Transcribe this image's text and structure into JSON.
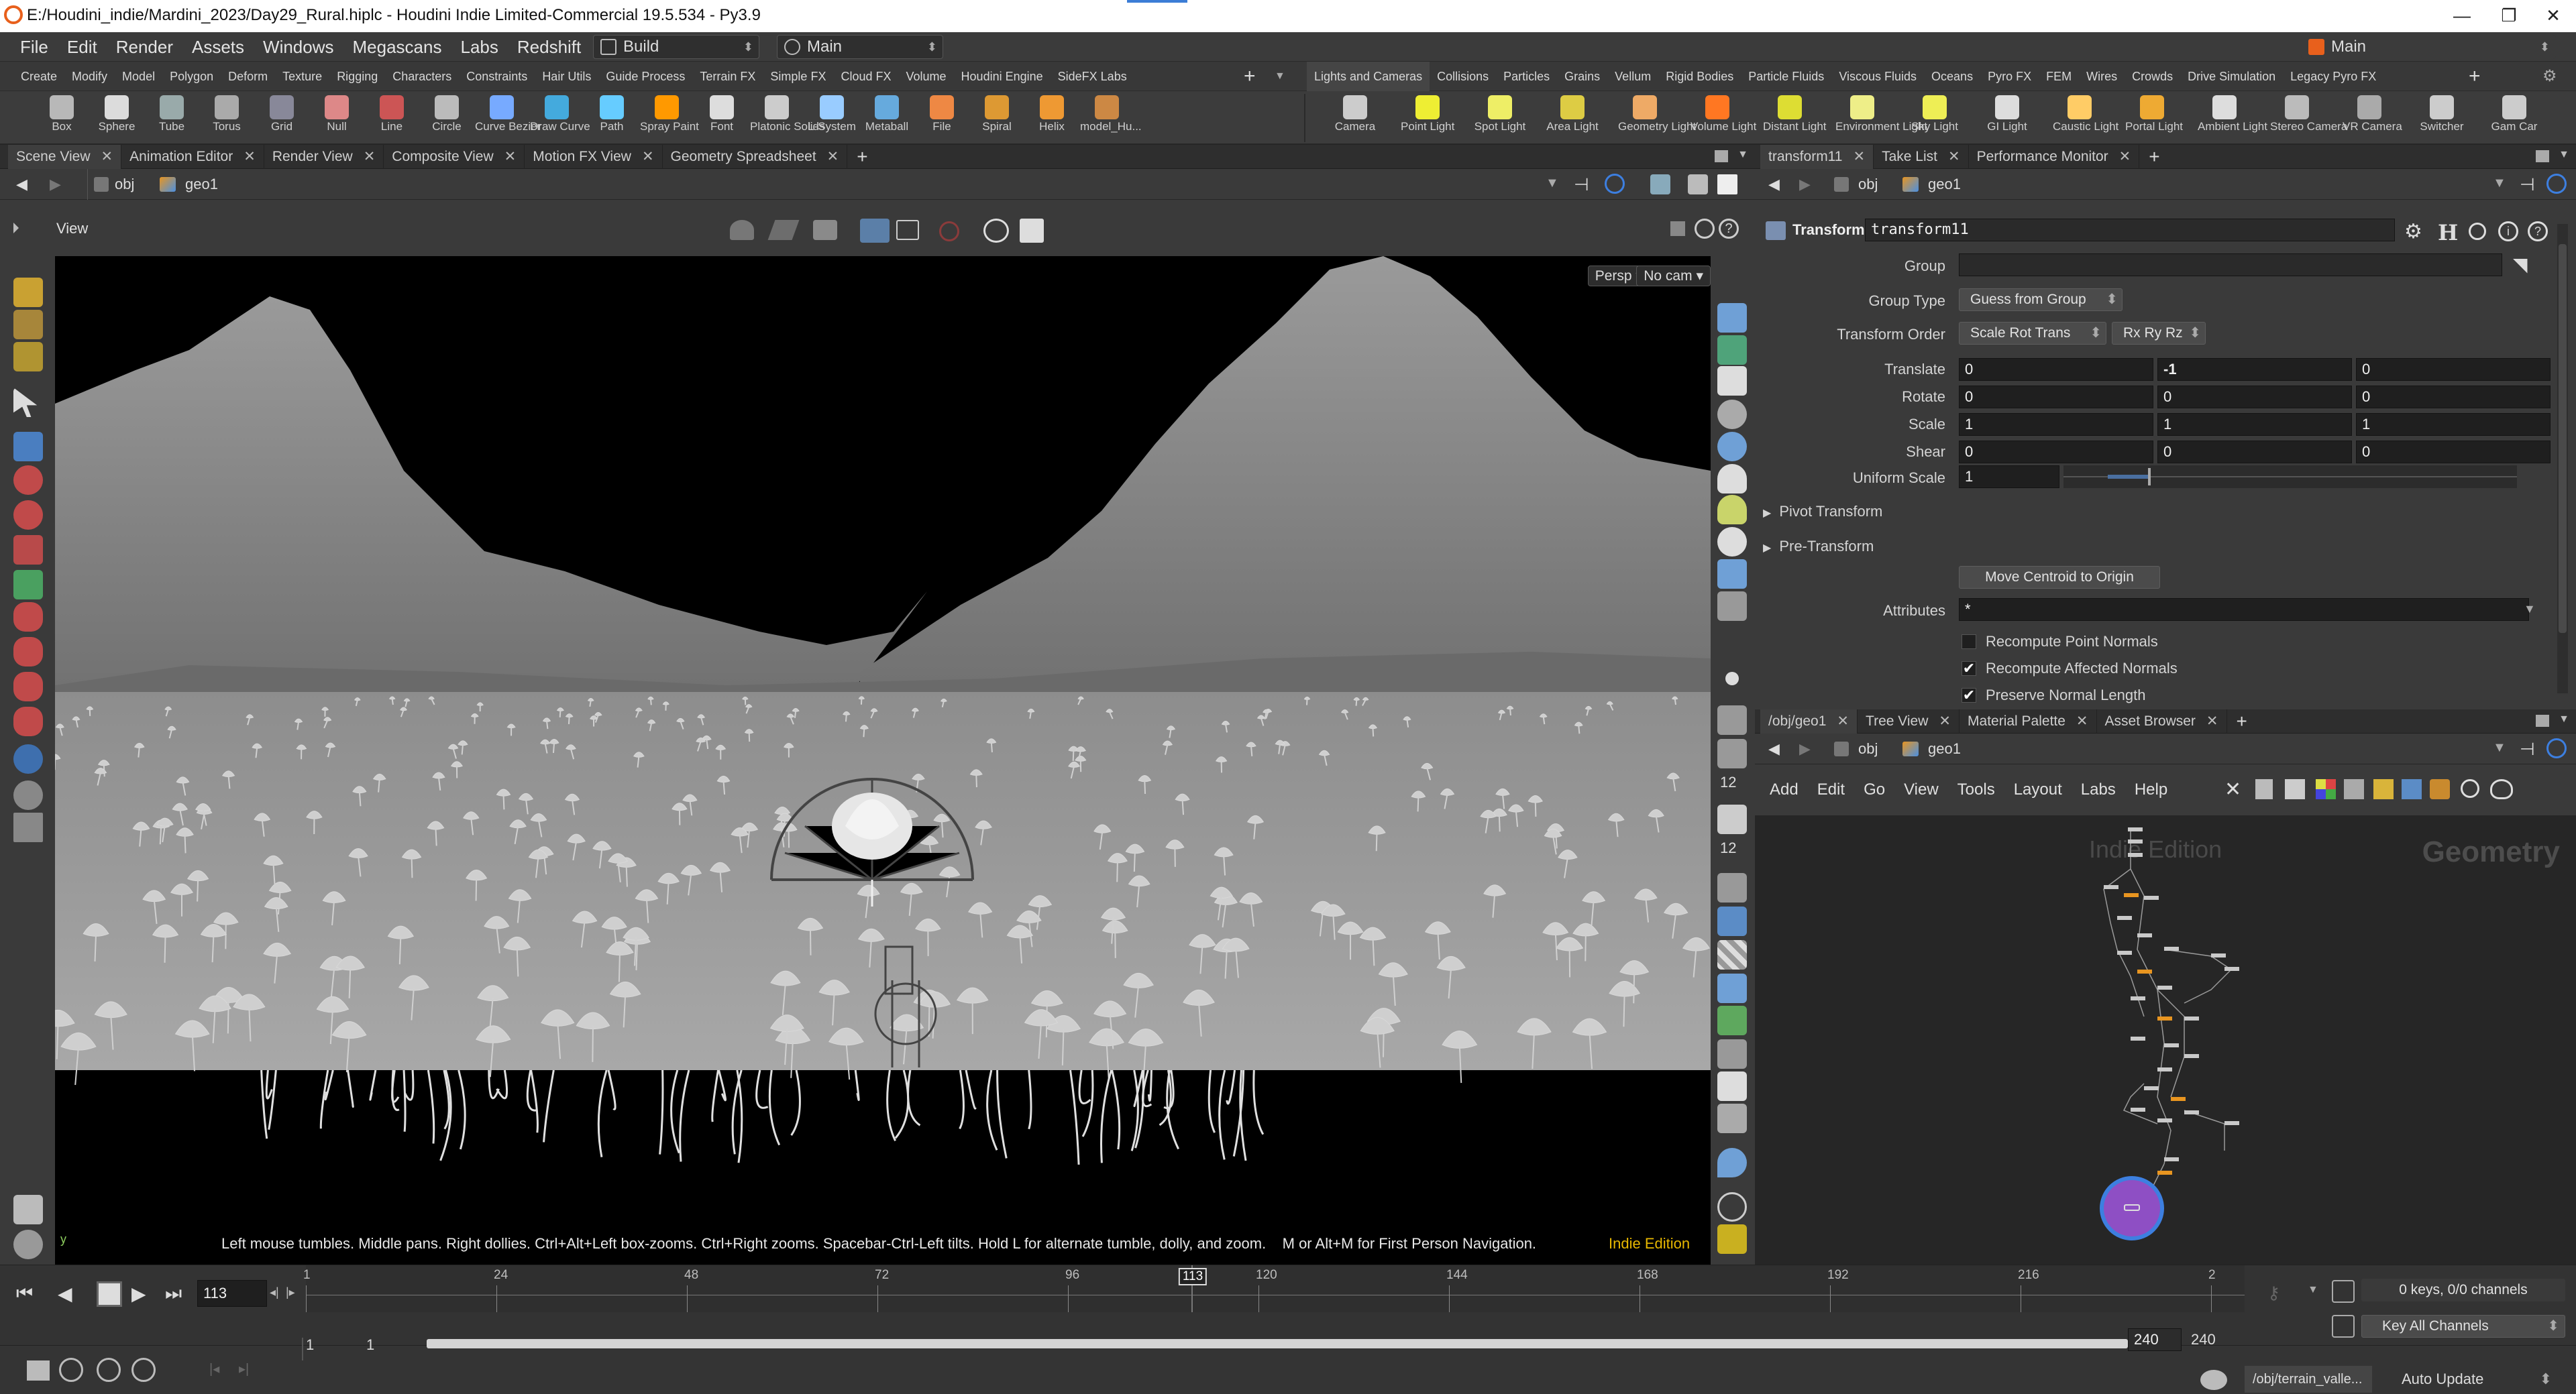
{
  "window": {
    "title": "E:/Houdini_indie/Mardini_2023/Day29_Rural.hiplc - Houdini Indie Limited-Commercial 19.5.534 - Py3.9",
    "controls": [
      "—",
      "❐",
      "✕"
    ]
  },
  "menubar": {
    "items": [
      "File",
      "Edit",
      "Render",
      "Assets",
      "Windows",
      "Megascans",
      "Labs",
      "Redshift",
      "Help"
    ],
    "desktop": "Build",
    "workspace": "Main",
    "right_workspace": "Main"
  },
  "shelf": {
    "left_tabs": [
      "Create",
      "Modify",
      "Model",
      "Polygon",
      "Deform",
      "Texture",
      "Rigging",
      "Characters",
      "Constraints",
      "Hair Utils",
      "Guide Process",
      "Terrain FX",
      "Simple FX",
      "Cloud FX",
      "Volume",
      "Houdini Engine",
      "SideFX Labs"
    ],
    "right_tabs": [
      "Lights and Cameras",
      "Collisions",
      "Particles",
      "Grains",
      "Vellum",
      "Rigid Bodies",
      "Particle Fluids",
      "Viscous Fluids",
      "Oceans",
      "Pyro FX",
      "FEM",
      "Wires",
      "Crowds",
      "Drive Simulation",
      "Legacy Pyro FX"
    ],
    "left_tools": [
      "Box",
      "Sphere",
      "Tube",
      "Torus",
      "Grid",
      "Null",
      "Line",
      "Circle",
      "Curve Bezier",
      "Draw Curve",
      "Path",
      "Spray Paint",
      "Font",
      "Platonic Solids",
      "L-System",
      "Metaball",
      "File",
      "Spiral",
      "Helix",
      "model_Hu..."
    ],
    "right_tools": [
      "Camera",
      "Point Light",
      "Spot Light",
      "Area Light",
      "Geometry Light",
      "Volume Light",
      "Distant Light",
      "Environment Light",
      "Sky Light",
      "GI Light",
      "Caustic Light",
      "Portal Light",
      "Ambient Light",
      "Stereo Camera",
      "VR Camera",
      "Switcher",
      "Gam Car"
    ]
  },
  "left_pane": {
    "tabs": [
      "Scene View",
      "Animation Editor",
      "Render View",
      "Composite View",
      "Motion FX View",
      "Geometry Spreadsheet"
    ],
    "path": [
      "obj",
      "geo1"
    ],
    "view_label": "View",
    "persp": "Persp",
    "cam": "No cam",
    "hint": "Left mouse tumbles. Middle pans. Right dollies. Ctrl+Alt+Left box-zooms. Ctrl+Right zooms. Spacebar-Ctrl-Left tilts. Hold L for alternate tumble, dolly, and zoom.    M or Alt+M for First Person Navigation.",
    "edition": "Indie Edition",
    "side_counts": [
      "12",
      "12"
    ]
  },
  "params_pane": {
    "tabs": [
      "transform11",
      "Take List",
      "Performance Monitor"
    ],
    "path": [
      "obj",
      "geo1"
    ],
    "node_type": "Transform",
    "node_name": "transform11",
    "group_label": "Group",
    "group_value": "",
    "group_type_label": "Group Type",
    "group_type": "Guess from Group",
    "transform_order_label": "Transform Order",
    "transform_order": "Scale Rot Trans",
    "rot_order": "Rx Ry Rz",
    "rows": [
      {
        "label": "Translate",
        "values": [
          "0",
          "-1",
          "0"
        ]
      },
      {
        "label": "Rotate",
        "values": [
          "0",
          "0",
          "0"
        ]
      },
      {
        "label": "Scale",
        "values": [
          "1",
          "1",
          "1"
        ]
      },
      {
        "label": "Shear",
        "values": [
          "0",
          "0",
          "0"
        ]
      }
    ],
    "uniform_scale_label": "Uniform Scale",
    "uniform_scale": "1",
    "folders": [
      "Pivot Transform",
      "Pre-Transform"
    ],
    "move_centroid": "Move Centroid to Origin",
    "attributes_label": "Attributes",
    "attributes": "*",
    "checks": [
      {
        "label": "Recompute Point Normals",
        "checked": false
      },
      {
        "label": "Recompute Affected Normals",
        "checked": true
      },
      {
        "label": "Preserve Normal Length",
        "checked": true
      }
    ]
  },
  "network_pane": {
    "tabs": [
      "/obj/geo1",
      "Tree View",
      "Material Palette",
      "Asset Browser"
    ],
    "path": [
      "obj",
      "geo1"
    ],
    "menu": [
      "Add",
      "Edit",
      "Go",
      "View",
      "Tools",
      "Layout",
      "Labs",
      "Help"
    ],
    "watermark_edition": "Indie Edition",
    "watermark_context": "Geometry"
  },
  "timeline": {
    "frame": "113",
    "current_marker": "113",
    "ticks": [
      "1",
      "24",
      "48",
      "72",
      "96",
      "120",
      "144",
      "168",
      "192",
      "216",
      "2"
    ],
    "start": "1",
    "start2": "1",
    "end": "240",
    "end2": "240",
    "keys": "0 keys, 0/0 channels",
    "key_all": "Key All Channels"
  },
  "status": {
    "path": "/obj/terrain_valle...",
    "update": "Auto Update"
  },
  "colors": {
    "accent_orange": "#e89520",
    "node_purple": "#8e4fc4",
    "node_ring": "#3d7fe0"
  }
}
